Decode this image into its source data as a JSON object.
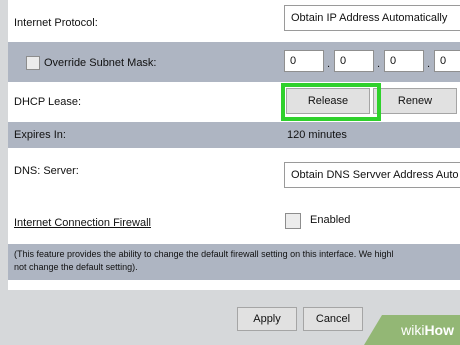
{
  "internet_protocol": {
    "label": "Internet Protocol:",
    "selected": "Obtain IP Address Automatically"
  },
  "subnet": {
    "label": "Override Subnet Mask:",
    "octets": [
      "0",
      "0",
      "0",
      "0"
    ],
    "separator": "."
  },
  "dhcp": {
    "label": "DHCP Lease:",
    "release_label": "Release",
    "renew_label": "Renew",
    "highlight_color": "#2fd12c"
  },
  "expires": {
    "label": "Expires In:",
    "value": "120 minutes"
  },
  "dns": {
    "label": "DNS: Server:",
    "selected": "Obtain DNS Servver Address Auto"
  },
  "firewall": {
    "label": "Internet Connection Firewall",
    "checkbox_label": "Enabled",
    "note_line1": "(This feature provides the ability to change the default firewall setting on this interface. We highl",
    "note_line2": "not change the default setting)."
  },
  "footer": {
    "apply_label": "Apply",
    "cancel_label": "Cancel"
  },
  "watermark": {
    "prefix": "wiki",
    "suffix": "How",
    "color": "#93b775"
  }
}
